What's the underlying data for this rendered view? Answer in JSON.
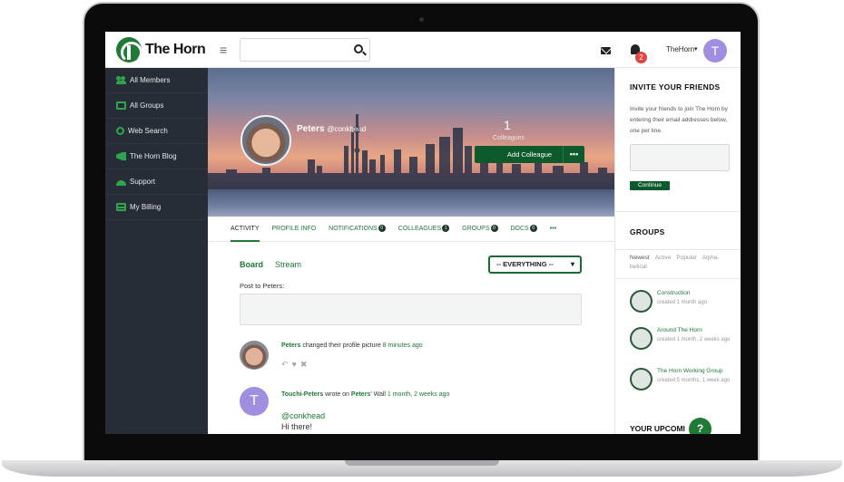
{
  "brand": {
    "name": "The Horn"
  },
  "header": {
    "search_placeholder": "",
    "notification_count": "2",
    "user_name": "TheHorn",
    "user_initial": "T"
  },
  "sidebar": {
    "items": [
      {
        "label": "All Members",
        "icon": "people-icon"
      },
      {
        "label": "All Groups",
        "icon": "groups-icon"
      },
      {
        "label": "Web Search",
        "icon": "web-search-icon"
      },
      {
        "label": "The Horn Blog",
        "icon": "megaphone-icon"
      },
      {
        "label": "Support",
        "icon": "support-icon"
      },
      {
        "label": "My Billing",
        "icon": "billing-icon"
      }
    ]
  },
  "profile": {
    "name": "Peters",
    "handle": "@conkhead",
    "stat_value": "1",
    "stat_label": "Colleagues",
    "add_colleague": "Add Colleague",
    "more": "•••"
  },
  "tabs": [
    {
      "label": "ACTIVITY",
      "badge": ""
    },
    {
      "label": "PROFILE INFO",
      "badge": ""
    },
    {
      "label": "NOTIFICATIONS",
      "badge": "0"
    },
    {
      "label": "COLLEAGUES",
      "badge": "1"
    },
    {
      "label": "GROUPS",
      "badge": "0"
    },
    {
      "label": "DOCS",
      "badge": "0"
    },
    {
      "label": "•••",
      "badge": ""
    }
  ],
  "activity": {
    "board": "Board",
    "stream": "Stream",
    "filter": "-- EVERYTHING --",
    "post_label": "Post to Peters:",
    "items": [
      {
        "name": "Peters",
        "action": " changed their profile picture ",
        "time": "8 minutes ago"
      },
      {
        "name": "Touchi-Peters",
        "action": " wrote on ",
        "target": "Peters",
        "target_suffix": "' Wall ",
        "time": "1 month, 2 weeks ago",
        "mention": "@conkhead",
        "body": "Hi there!",
        "initial": "T"
      }
    ]
  },
  "invite": {
    "title": "INVITE YOUR FRIENDS",
    "description": "Invite your friends to join The Horn by entering their email addresses below, one per line.",
    "button": "Continue"
  },
  "groups": {
    "title": "GROUPS",
    "filters": [
      "Newest",
      "Active",
      "Popular",
      "Alpha-betical"
    ],
    "items": [
      {
        "name": "Construction",
        "meta": "created 1 month ago"
      },
      {
        "name": "Around The Horn",
        "meta": "created 1 month, 2 weeks ago"
      },
      {
        "name": "The Horn Working Group",
        "meta": "created 5 months, 1 week ago"
      }
    ]
  },
  "upcoming": {
    "title": "YOUR UPCOMI"
  },
  "help": {
    "label": "?"
  }
}
